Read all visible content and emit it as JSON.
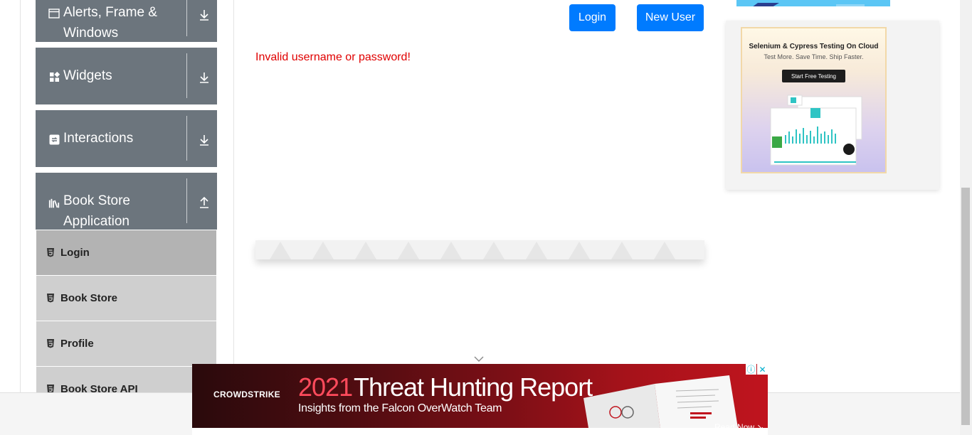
{
  "sidebar": {
    "groups": [
      {
        "title": "Alerts, Frame & Windows",
        "icon": "window-icon",
        "arrow": "download-arrow-icon"
      },
      {
        "title": "Widgets",
        "icon": "widgets-icon",
        "arrow": "download-arrow-icon"
      },
      {
        "title": "Interactions",
        "icon": "interactions-icon",
        "arrow": "download-arrow-icon"
      },
      {
        "title": "Book Store Application",
        "icon": "books-icon",
        "arrow": "upload-arrow-icon"
      }
    ],
    "items": [
      {
        "label": "Login",
        "active": true
      },
      {
        "label": "Book Store"
      },
      {
        "label": "Profile"
      },
      {
        "label": "Book Store API"
      }
    ]
  },
  "main": {
    "login_button": "Login",
    "new_user_button": "New User",
    "error_message": "Invalid username or password!"
  },
  "side_ad": {
    "headline": "Selenium & Cypress Testing On Cloud",
    "tagline": "Test More. Save Time. Ship Faster.",
    "cta": "Start Free Testing"
  },
  "banner_ad": {
    "brand": "CROWDSTRIKE",
    "year": "2021",
    "title": "Threat Hunting Report",
    "subtitle": "Insights from the Falcon OverWatch Team",
    "cta": "Read Now ↘"
  },
  "colors": {
    "group_bg": "#6c757d",
    "primary_button": "#007bff",
    "error": "#e00000",
    "submenu_bg": "#cfcfcf",
    "submenu_active_bg": "#b3b3b3"
  }
}
